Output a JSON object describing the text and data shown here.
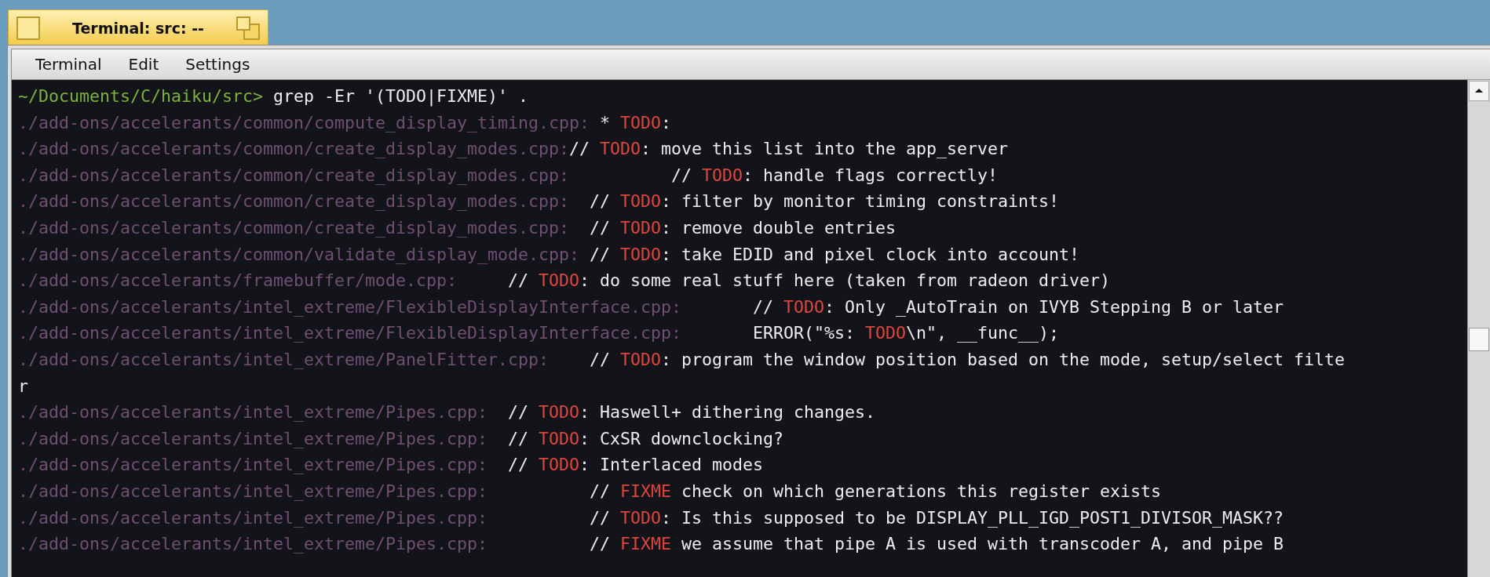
{
  "window": {
    "title": "Terminal: src: --"
  },
  "menu": [
    "Terminal",
    "Edit",
    "Settings"
  ],
  "terminal": {
    "lines": [
      {
        "segments": [
          {
            "kind": "prompt",
            "text": "~/Documents/C/haiku/src>"
          },
          {
            "kind": "text",
            "text": " grep -Er '(TODO|FIXME)' ."
          }
        ]
      },
      {
        "segments": [
          {
            "kind": "path",
            "text": "./add-ons/accelerants/common/compute_display_timing.cpp:"
          },
          {
            "kind": "text",
            "text": " * "
          },
          {
            "kind": "match",
            "text": "TODO"
          },
          {
            "kind": "text",
            "text": ":"
          }
        ]
      },
      {
        "segments": [
          {
            "kind": "path",
            "text": "./add-ons/accelerants/common/create_display_modes.cpp:"
          },
          {
            "kind": "text",
            "text": "// "
          },
          {
            "kind": "match",
            "text": "TODO"
          },
          {
            "kind": "text",
            "text": ": move this list into the app_server"
          }
        ]
      },
      {
        "segments": [
          {
            "kind": "path",
            "text": "./add-ons/accelerants/common/create_display_modes.cpp:"
          },
          {
            "kind": "text",
            "text": "          // "
          },
          {
            "kind": "match",
            "text": "TODO"
          },
          {
            "kind": "text",
            "text": ": handle flags correctly!"
          }
        ]
      },
      {
        "segments": [
          {
            "kind": "path",
            "text": "./add-ons/accelerants/common/create_display_modes.cpp:"
          },
          {
            "kind": "text",
            "text": "  // "
          },
          {
            "kind": "match",
            "text": "TODO"
          },
          {
            "kind": "text",
            "text": ": filter by monitor timing constraints!"
          }
        ]
      },
      {
        "segments": [
          {
            "kind": "path",
            "text": "./add-ons/accelerants/common/create_display_modes.cpp:"
          },
          {
            "kind": "text",
            "text": "  // "
          },
          {
            "kind": "match",
            "text": "TODO"
          },
          {
            "kind": "text",
            "text": ": remove double entries"
          }
        ]
      },
      {
        "segments": [
          {
            "kind": "path",
            "text": "./add-ons/accelerants/common/validate_display_mode.cpp:"
          },
          {
            "kind": "text",
            "text": " // "
          },
          {
            "kind": "match",
            "text": "TODO"
          },
          {
            "kind": "text",
            "text": ": take EDID and pixel clock into account!"
          }
        ]
      },
      {
        "segments": [
          {
            "kind": "path",
            "text": "./add-ons/accelerants/framebuffer/mode.cpp:"
          },
          {
            "kind": "text",
            "text": "     // "
          },
          {
            "kind": "match",
            "text": "TODO"
          },
          {
            "kind": "text",
            "text": ": do some real stuff here (taken from radeon driver)"
          }
        ]
      },
      {
        "segments": [
          {
            "kind": "path",
            "text": "./add-ons/accelerants/intel_extreme/FlexibleDisplayInterface.cpp:"
          },
          {
            "kind": "text",
            "text": "       // "
          },
          {
            "kind": "match",
            "text": "TODO"
          },
          {
            "kind": "text",
            "text": ": Only _AutoTrain on IVYB Stepping B or later"
          }
        ]
      },
      {
        "segments": [
          {
            "kind": "path",
            "text": "./add-ons/accelerants/intel_extreme/FlexibleDisplayInterface.cpp:"
          },
          {
            "kind": "text",
            "text": "       ERROR(\"%s: "
          },
          {
            "kind": "match",
            "text": "TODO"
          },
          {
            "kind": "text",
            "text": "\\n\", __func__);"
          }
        ]
      },
      {
        "segments": [
          {
            "kind": "path",
            "text": "./add-ons/accelerants/intel_extreme/PanelFitter.cpp:"
          },
          {
            "kind": "text",
            "text": "    // "
          },
          {
            "kind": "match",
            "text": "TODO"
          },
          {
            "kind": "text",
            "text": ": program the window position based on the mode, setup/select filte"
          }
        ]
      },
      {
        "segments": [
          {
            "kind": "text",
            "text": "r"
          }
        ]
      },
      {
        "segments": [
          {
            "kind": "path",
            "text": "./add-ons/accelerants/intel_extreme/Pipes.cpp:"
          },
          {
            "kind": "text",
            "text": "  // "
          },
          {
            "kind": "match",
            "text": "TODO"
          },
          {
            "kind": "text",
            "text": ": Haswell+ dithering changes."
          }
        ]
      },
      {
        "segments": [
          {
            "kind": "path",
            "text": "./add-ons/accelerants/intel_extreme/Pipes.cpp:"
          },
          {
            "kind": "text",
            "text": "  // "
          },
          {
            "kind": "match",
            "text": "TODO"
          },
          {
            "kind": "text",
            "text": ": CxSR downclocking?"
          }
        ]
      },
      {
        "segments": [
          {
            "kind": "path",
            "text": "./add-ons/accelerants/intel_extreme/Pipes.cpp:"
          },
          {
            "kind": "text",
            "text": "  // "
          },
          {
            "kind": "match",
            "text": "TODO"
          },
          {
            "kind": "text",
            "text": ": Interlaced modes"
          }
        ]
      },
      {
        "segments": [
          {
            "kind": "path",
            "text": "./add-ons/accelerants/intel_extreme/Pipes.cpp:"
          },
          {
            "kind": "text",
            "text": "          // "
          },
          {
            "kind": "match",
            "text": "FIXME"
          },
          {
            "kind": "text",
            "text": " check on which generations this register exists"
          }
        ]
      },
      {
        "segments": [
          {
            "kind": "path",
            "text": "./add-ons/accelerants/intel_extreme/Pipes.cpp:"
          },
          {
            "kind": "text",
            "text": "          // "
          },
          {
            "kind": "match",
            "text": "TODO"
          },
          {
            "kind": "text",
            "text": ": Is this supposed to be DISPLAY_PLL_IGD_POST1_DIVISOR_MASK??"
          }
        ]
      },
      {
        "segments": [
          {
            "kind": "path",
            "text": "./add-ons/accelerants/intel_extreme/Pipes.cpp:"
          },
          {
            "kind": "text",
            "text": "          // "
          },
          {
            "kind": "match",
            "text": "FIXME"
          },
          {
            "kind": "text",
            "text": " we assume that pipe A is used with transcoder A, and pipe B"
          }
        ]
      }
    ]
  }
}
